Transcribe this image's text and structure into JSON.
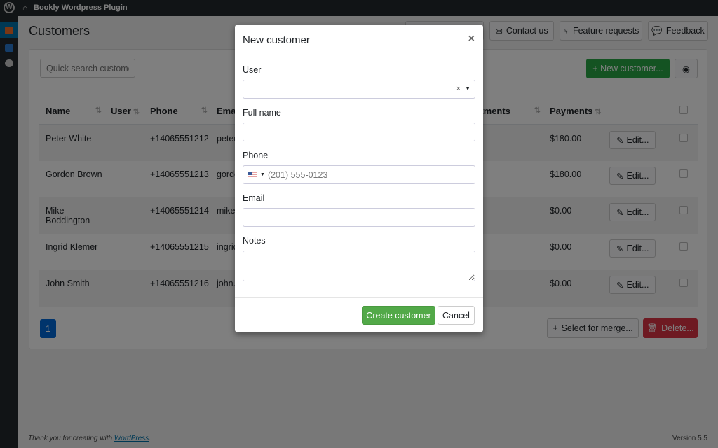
{
  "adminbar": {
    "site_name": "Bookly Wordpress Plugin",
    "wp_logo": "wordpress-icon",
    "home_icon": "home-icon"
  },
  "page": {
    "title": "Customers"
  },
  "toolbar": {
    "contact": "Contact us",
    "features": "Feature requests",
    "feedback": "Feedback"
  },
  "panel": {
    "search_placeholder": "Quick search customer",
    "new_customer": "+ New customer...",
    "eye_icon": "eye-icon"
  },
  "table": {
    "headers": [
      "Name",
      "User",
      "Phone",
      "Emai",
      "Total appointments",
      "Payments"
    ],
    "rows": [
      {
        "name": "Peter White",
        "phone": "+14065551212",
        "email": "peter",
        "payments": "$180.00"
      },
      {
        "name": "Gordon Brown",
        "phone": "+14065551213",
        "email": "gordo",
        "payments": "$180.00"
      },
      {
        "name": "Mike Boddington",
        "phone": "+14065551214",
        "email": "mike.",
        "payments": "$0.00"
      },
      {
        "name": "Ingrid Klemer",
        "phone": "+14065551215",
        "email": "ingrid",
        "payments": "$0.00"
      },
      {
        "name": "John Smith",
        "phone": "+14065551216",
        "email": "john.",
        "payments": "$0.00"
      }
    ],
    "edit_label": "Edit..."
  },
  "pagination": {
    "current": "1"
  },
  "actions": {
    "merge": "Select for merge...",
    "delete": "Delete..."
  },
  "footer": {
    "thanks": "Thank you for creating with ",
    "link": "WordPress",
    "period": ".",
    "version": "Version 5.5"
  },
  "modal": {
    "title": "New customer",
    "close": "×",
    "user_label": "User",
    "fullname_label": "Full name",
    "phone_label": "Phone",
    "phone_placeholder": "(201) 555-0123",
    "email_label": "Email",
    "notes_label": "Notes",
    "create": "Create customer",
    "cancel": "Cancel"
  },
  "colors": {
    "primary": "#0069d9",
    "success": "#28a745",
    "danger": "#dc3545",
    "modal_success": "#52a948"
  }
}
